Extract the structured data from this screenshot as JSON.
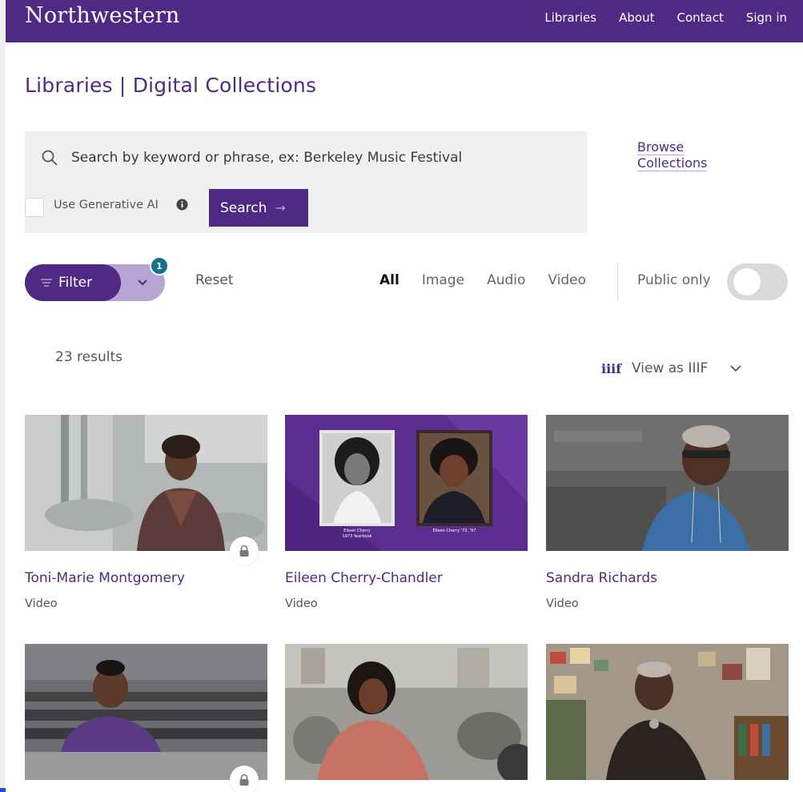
{
  "header": {
    "brand": "Northwestern",
    "nav": [
      "Libraries",
      "About",
      "Contact",
      "Sign in"
    ],
    "background": "#4e2a84"
  },
  "page": {
    "title": "Libraries | Digital Collections"
  },
  "search": {
    "placeholder": "Search by keyword or phrase, ex: Berkeley Music Festival",
    "generative_label": "Use Generative AI",
    "generative_checked": false,
    "button_label": "Search",
    "icon": "search-icon"
  },
  "browse": {
    "line1": "Browse",
    "line2": "Collections"
  },
  "filters": {
    "filter_label": "Filter",
    "active_count": "1",
    "reset_label": "Reset",
    "tabs": [
      {
        "label": "All",
        "active": true
      },
      {
        "label": "Image",
        "active": false
      },
      {
        "label": "Audio",
        "active": false
      },
      {
        "label": "Video",
        "active": false
      }
    ],
    "public_only_label": "Public only",
    "public_only_on": false
  },
  "results": {
    "count_text": "23 results",
    "iiif_icon_text": "iiif",
    "view_as_label": "View as IIIF",
    "items": [
      {
        "title": "Toni-Marie Montgomery",
        "type": "Video",
        "restricted": true
      },
      {
        "title": "Eileen Cherry-Chandler",
        "type": "Video",
        "restricted": false,
        "caption_left": "Eileen Cherry\n1973 Yearbook",
        "caption_right": "Eileen Cherry '73, '97"
      },
      {
        "title": "Sandra Richards",
        "type": "Video",
        "restricted": false
      },
      {
        "title": "",
        "type": "",
        "restricted": true
      },
      {
        "title": "",
        "type": "",
        "restricted": false
      },
      {
        "title": "",
        "type": "",
        "restricted": false
      }
    ]
  },
  "colors": {
    "accent": "#4e2a84",
    "accent_light": "#b6a4d4",
    "badge": "#14728a",
    "panel": "#f0f0f0"
  }
}
